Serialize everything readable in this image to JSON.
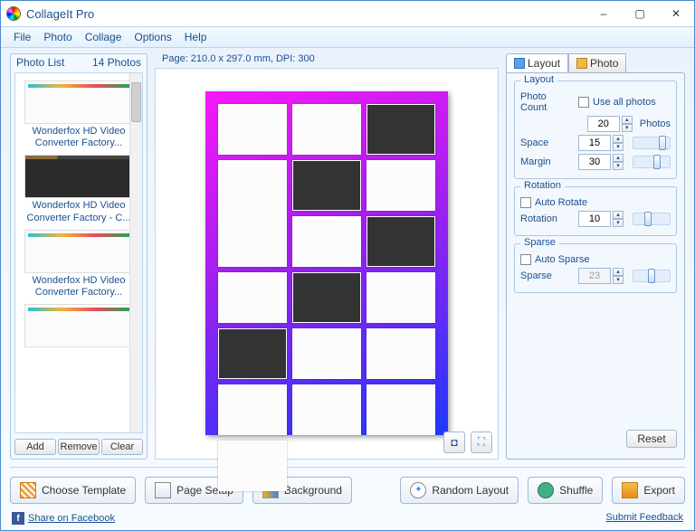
{
  "app": {
    "title": "CollageIt Pro"
  },
  "menu": {
    "file": "File",
    "photo": "Photo",
    "collage": "Collage",
    "options": "Options",
    "help": "Help"
  },
  "photoList": {
    "title": "Photo List",
    "count": "14 Photos",
    "items": [
      {
        "caption": "Wonderfox HD Video Converter Factory..."
      },
      {
        "caption": "Wonderfox HD Video Converter Factory - C..."
      },
      {
        "caption": "Wonderfox HD Video Converter Factory..."
      }
    ],
    "add": "Add",
    "remove": "Remove",
    "clear": "Clear"
  },
  "page": {
    "info": "Page: 210.0 x 297.0 mm, DPI: 300"
  },
  "tabs": {
    "layout": "Layout",
    "photo": "Photo"
  },
  "layout": {
    "groupTitle": "Layout",
    "photoCount": "Photo Count",
    "useAll": "Use all photos",
    "photosValue": "20",
    "photosLabel": "Photos",
    "space": "Space",
    "spaceValue": "15",
    "margin": "Margin",
    "marginValue": "30"
  },
  "rotation": {
    "groupTitle": "Rotation",
    "auto": "Auto Rotate",
    "label": "Rotation",
    "value": "10"
  },
  "sparse": {
    "groupTitle": "Sparse",
    "auto": "Auto Sparse",
    "label": "Sparse",
    "value": "23"
  },
  "buttons": {
    "reset": "Reset",
    "chooseTemplate": "Choose Template",
    "pageSetup": "Page Setup",
    "background": "Background",
    "randomLayout": "Random Layout",
    "shuffle": "Shuffle",
    "export": "Export"
  },
  "footer": {
    "share": "Share on Facebook",
    "feedback": "Submit Feedback"
  }
}
